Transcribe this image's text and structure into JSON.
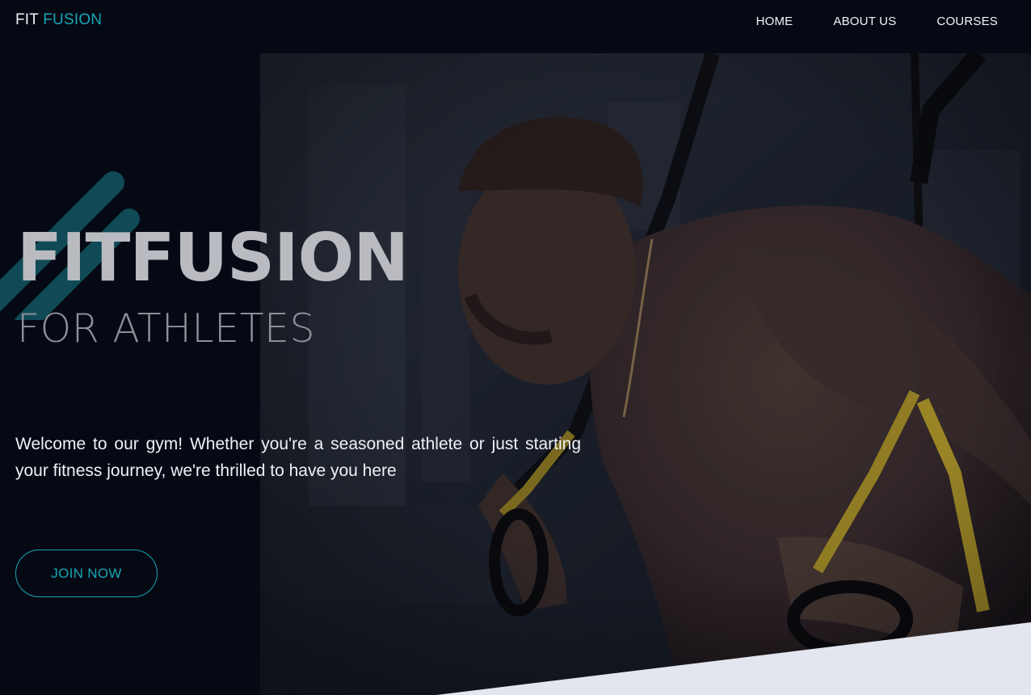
{
  "nav": {
    "brand_main": "FIT",
    "brand_accent": "FUSION",
    "links": [
      {
        "label": "HOME"
      },
      {
        "label": "ABOUT US"
      },
      {
        "label": "COURSES"
      }
    ]
  },
  "hero": {
    "title": "FITFUSION",
    "subtitle": "FOR ATHLETES",
    "description": "Welcome to our gym! Whether you're a seasoned athlete or just starting your fitness journey, we're thrilled to have you here",
    "cta_label": "JOIN NOW"
  },
  "colors": {
    "background": "#050914",
    "accent": "#17a7b7",
    "light_wedge": "#e3e6ef"
  },
  "icons": {
    "decoration": "diagonal-stripes"
  }
}
